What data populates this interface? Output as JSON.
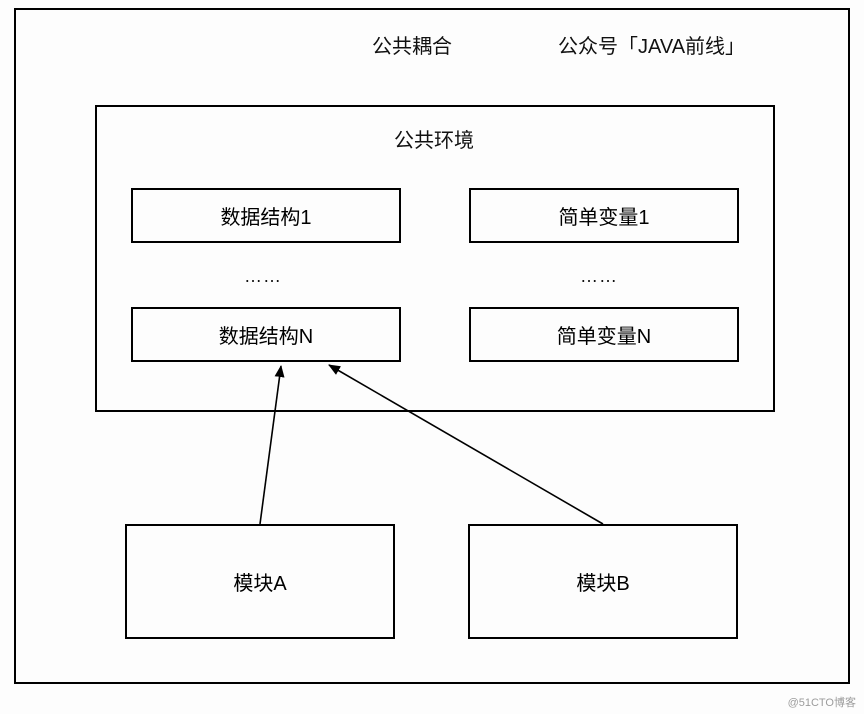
{
  "header": {
    "title": "公共耦合",
    "author": "公众号「JAVA前线」"
  },
  "env": {
    "title": "公共环境"
  },
  "left": {
    "top": "数据结构1",
    "dots": "……",
    "bottom": "数据结构N"
  },
  "right": {
    "top": "简单变量1",
    "dots": "……",
    "bottom": "简单变量N"
  },
  "modules": {
    "a": "模块A",
    "b": "模块B"
  },
  "watermark": "@51CTO博客"
}
